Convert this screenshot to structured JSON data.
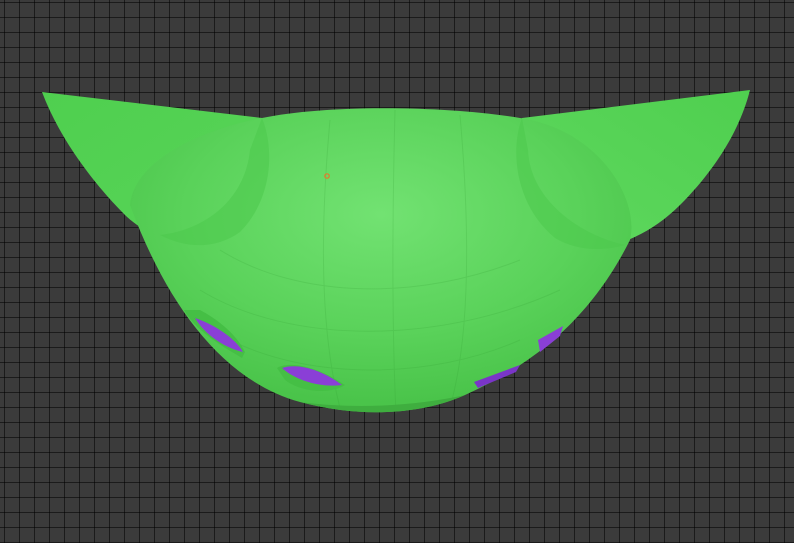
{
  "viewport": {
    "background": "#3b3b3b",
    "grid_line_color": "#222222",
    "model": {
      "body_color": "#55d155",
      "highlight_color": "#6fe06f",
      "shade_color": "#41b841",
      "rim_color": "#2f9a2f",
      "hole_color": "#8a3fd6",
      "hole_dark": "#5c21a3",
      "origin_marker_color": "#e8772a"
    }
  }
}
